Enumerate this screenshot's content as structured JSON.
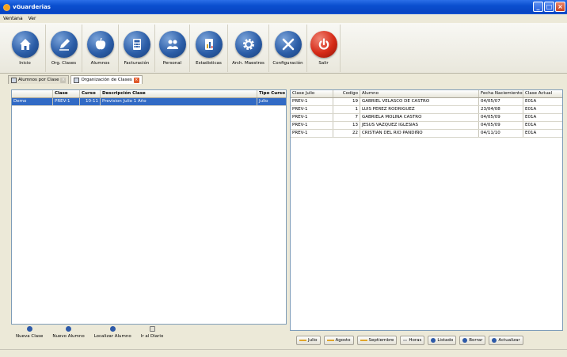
{
  "window": {
    "title": "vGuarderias"
  },
  "menu": [
    "Ventana",
    "Ver"
  ],
  "toolbar": [
    {
      "label": "Inicio",
      "icon": "home-icon"
    },
    {
      "label": "Org. Clases",
      "icon": "pencil-icon"
    },
    {
      "label": "Alumnos",
      "icon": "apple-icon"
    },
    {
      "label": "Facturación",
      "icon": "calculator-icon"
    },
    {
      "label": "Personal",
      "icon": "people-icon"
    },
    {
      "label": "Estadisticas",
      "icon": "stats-icon"
    },
    {
      "label": "Arch. Maestros",
      "icon": "gear-icon"
    },
    {
      "label": "Configuración",
      "icon": "tools-icon"
    },
    {
      "label": "Salir",
      "icon": "power-icon"
    }
  ],
  "tabs": [
    {
      "label": "Alumnos por Clase"
    },
    {
      "label": "Organización de Clases"
    }
  ],
  "left_grid": {
    "columns": [
      "",
      "Clase",
      "Curso",
      "Descripción Clase",
      "Tipo Curso"
    ],
    "rows": [
      [
        "Demo",
        "PREV-1",
        "10-11",
        "Prevision Julio 1 Año",
        "Julio"
      ]
    ]
  },
  "right_grid": {
    "columns": [
      "Clase Julio",
      "Codigo",
      "Alumno",
      "Fecha Naciemiento",
      "Clase Actual"
    ],
    "rows": [
      [
        "PREV-1",
        "19",
        "GABRIEL VELASCO DE CASTRO",
        "04/05/07",
        "E01A"
      ],
      [
        "PREV-1",
        "1",
        "LUIS PEREZ RODRIGUEZ",
        "23/04/08",
        "E01A"
      ],
      [
        "PREV-1",
        "7",
        "GABRIELA MOLINA CASTRO",
        "04/05/09",
        "E01A"
      ],
      [
        "PREV-1",
        "13",
        "JESUS VAZQUEZ IGLESIAS",
        "04/05/09",
        "E01A"
      ],
      [
        "PREV-1",
        "22",
        "CRISTIAN DEL RIO PANDIÑO",
        "04/11/10",
        "E01A"
      ]
    ]
  },
  "left_actions": [
    "Nueva Clase",
    "Nuevo Alumno",
    "Localizar Alumno",
    "Ir al Diario"
  ],
  "right_actions": [
    "Julio",
    "Agosto",
    "Septiembre",
    "Horas",
    "Listado",
    "Borrar",
    "Actualizar"
  ]
}
